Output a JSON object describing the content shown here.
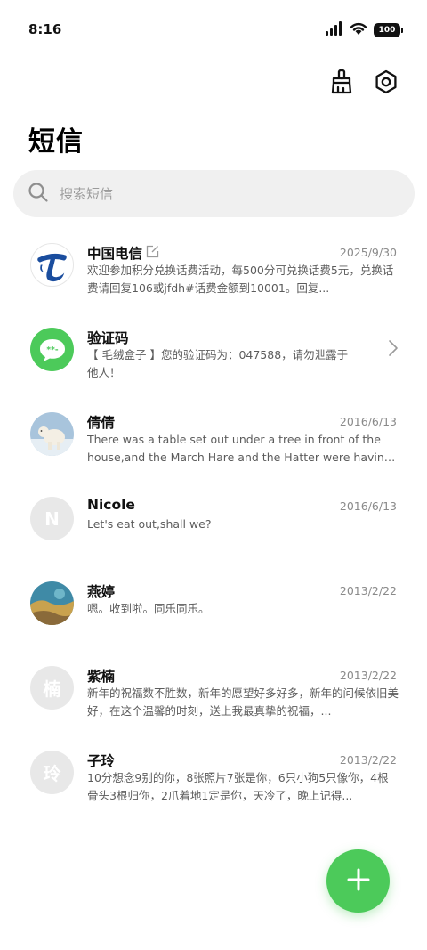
{
  "status": {
    "time": "8:16",
    "battery": "100"
  },
  "header": {
    "title": "短信"
  },
  "search": {
    "placeholder": "搜索短信"
  },
  "conversations": [
    {
      "name": "中国电信",
      "date": "2025/9/30",
      "preview": "欢迎参加积分兑换话费活动，每500分可兑换话费5元，兑换话费请回复106或jfdh#话费金额到10001。回复...",
      "avatar": "china-telecom-logo",
      "has_edit_icon": true
    },
    {
      "name": "验证码",
      "date": "",
      "preview": "【 毛绒盒子 】您的验证码为：047588，请勿泄露于他人！",
      "avatar": "message-bubble-icon",
      "has_chevron": true
    },
    {
      "name": "倩倩",
      "date": "2016/6/13",
      "preview": "There was a table set out under a tree in front of the house,and the March Hare and the Hatter were having ...",
      "avatar": "polar-bear-photo"
    },
    {
      "name": "Nicole",
      "date": "2016/6/13",
      "preview": "Let's eat out,shall we?",
      "avatar_letter": "N"
    },
    {
      "name": "燕婷",
      "date": "2013/2/22",
      "preview": "嗯。收到啦。同乐同乐。",
      "avatar": "landscape-photo"
    },
    {
      "name": "紫楠",
      "date": "2013/2/22",
      "preview": "新年的祝福数不胜数，新年的愿望好多好多，新年的问候依旧美好，在这个温馨的时刻，送上我最真挚的祝福，...",
      "avatar_letter": "楠"
    },
    {
      "name": "子玲",
      "date": "2013/2/22",
      "preview": "10分想念9别的你，8张照片7张是你，6只小狗5只像你，4根骨头3根归你，2爪着地1定是你，天冷了，晚上记得...",
      "avatar_letter": "玲"
    }
  ],
  "colors": {
    "accent": "#4cca5a",
    "telecom_blue": "#1a4d9e"
  }
}
